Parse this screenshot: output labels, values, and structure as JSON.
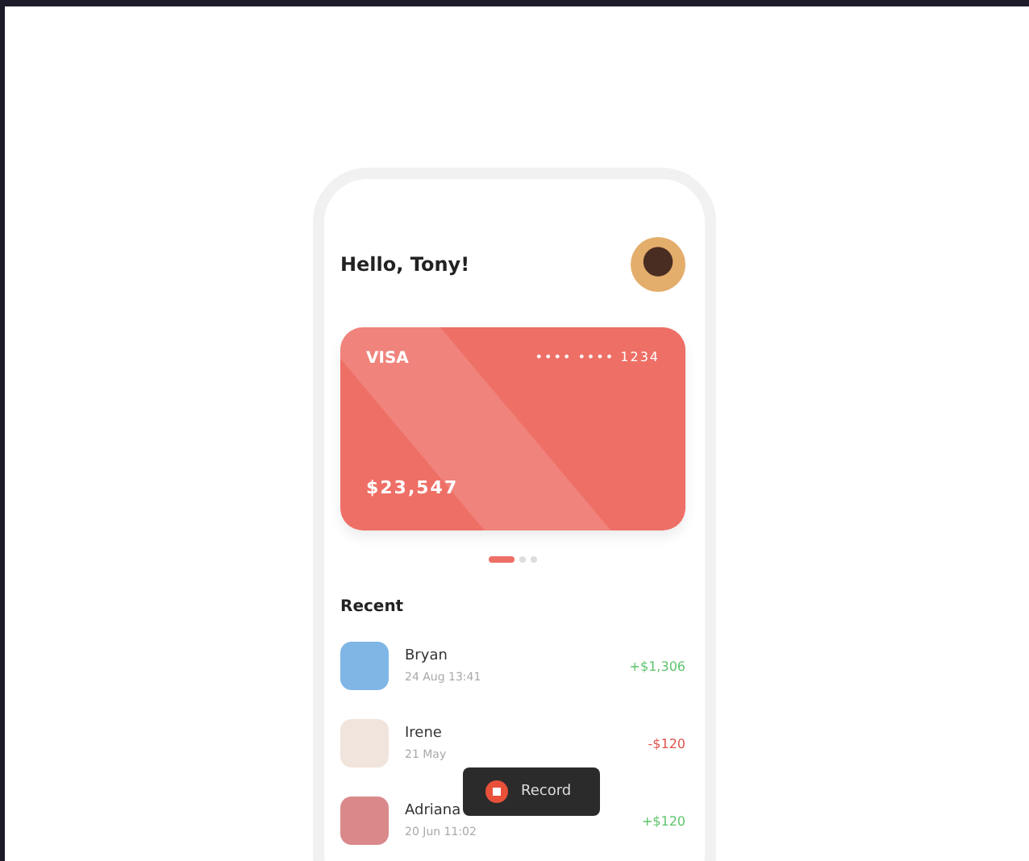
{
  "greeting": "Hello, Tony!",
  "card": {
    "brand": "VISA",
    "number": "•••• •••• 1234",
    "balance": "$23,547"
  },
  "pager": [
    {
      "selected": true
    },
    {
      "selected": false
    },
    {
      "selected": false
    }
  ],
  "recent": {
    "title": "Recent",
    "items": [
      {
        "name": "Bryan",
        "date": "24 Aug 13:41",
        "amount": "+$1,306",
        "kind": "income"
      },
      {
        "name": "Irene",
        "date": "21 May",
        "amount": "-$120",
        "kind": "expense"
      },
      {
        "name": "Adriana",
        "date": "20 Jun 11:02",
        "amount": "+$120",
        "kind": "income"
      }
    ]
  },
  "record_button": {
    "label": "Record"
  }
}
